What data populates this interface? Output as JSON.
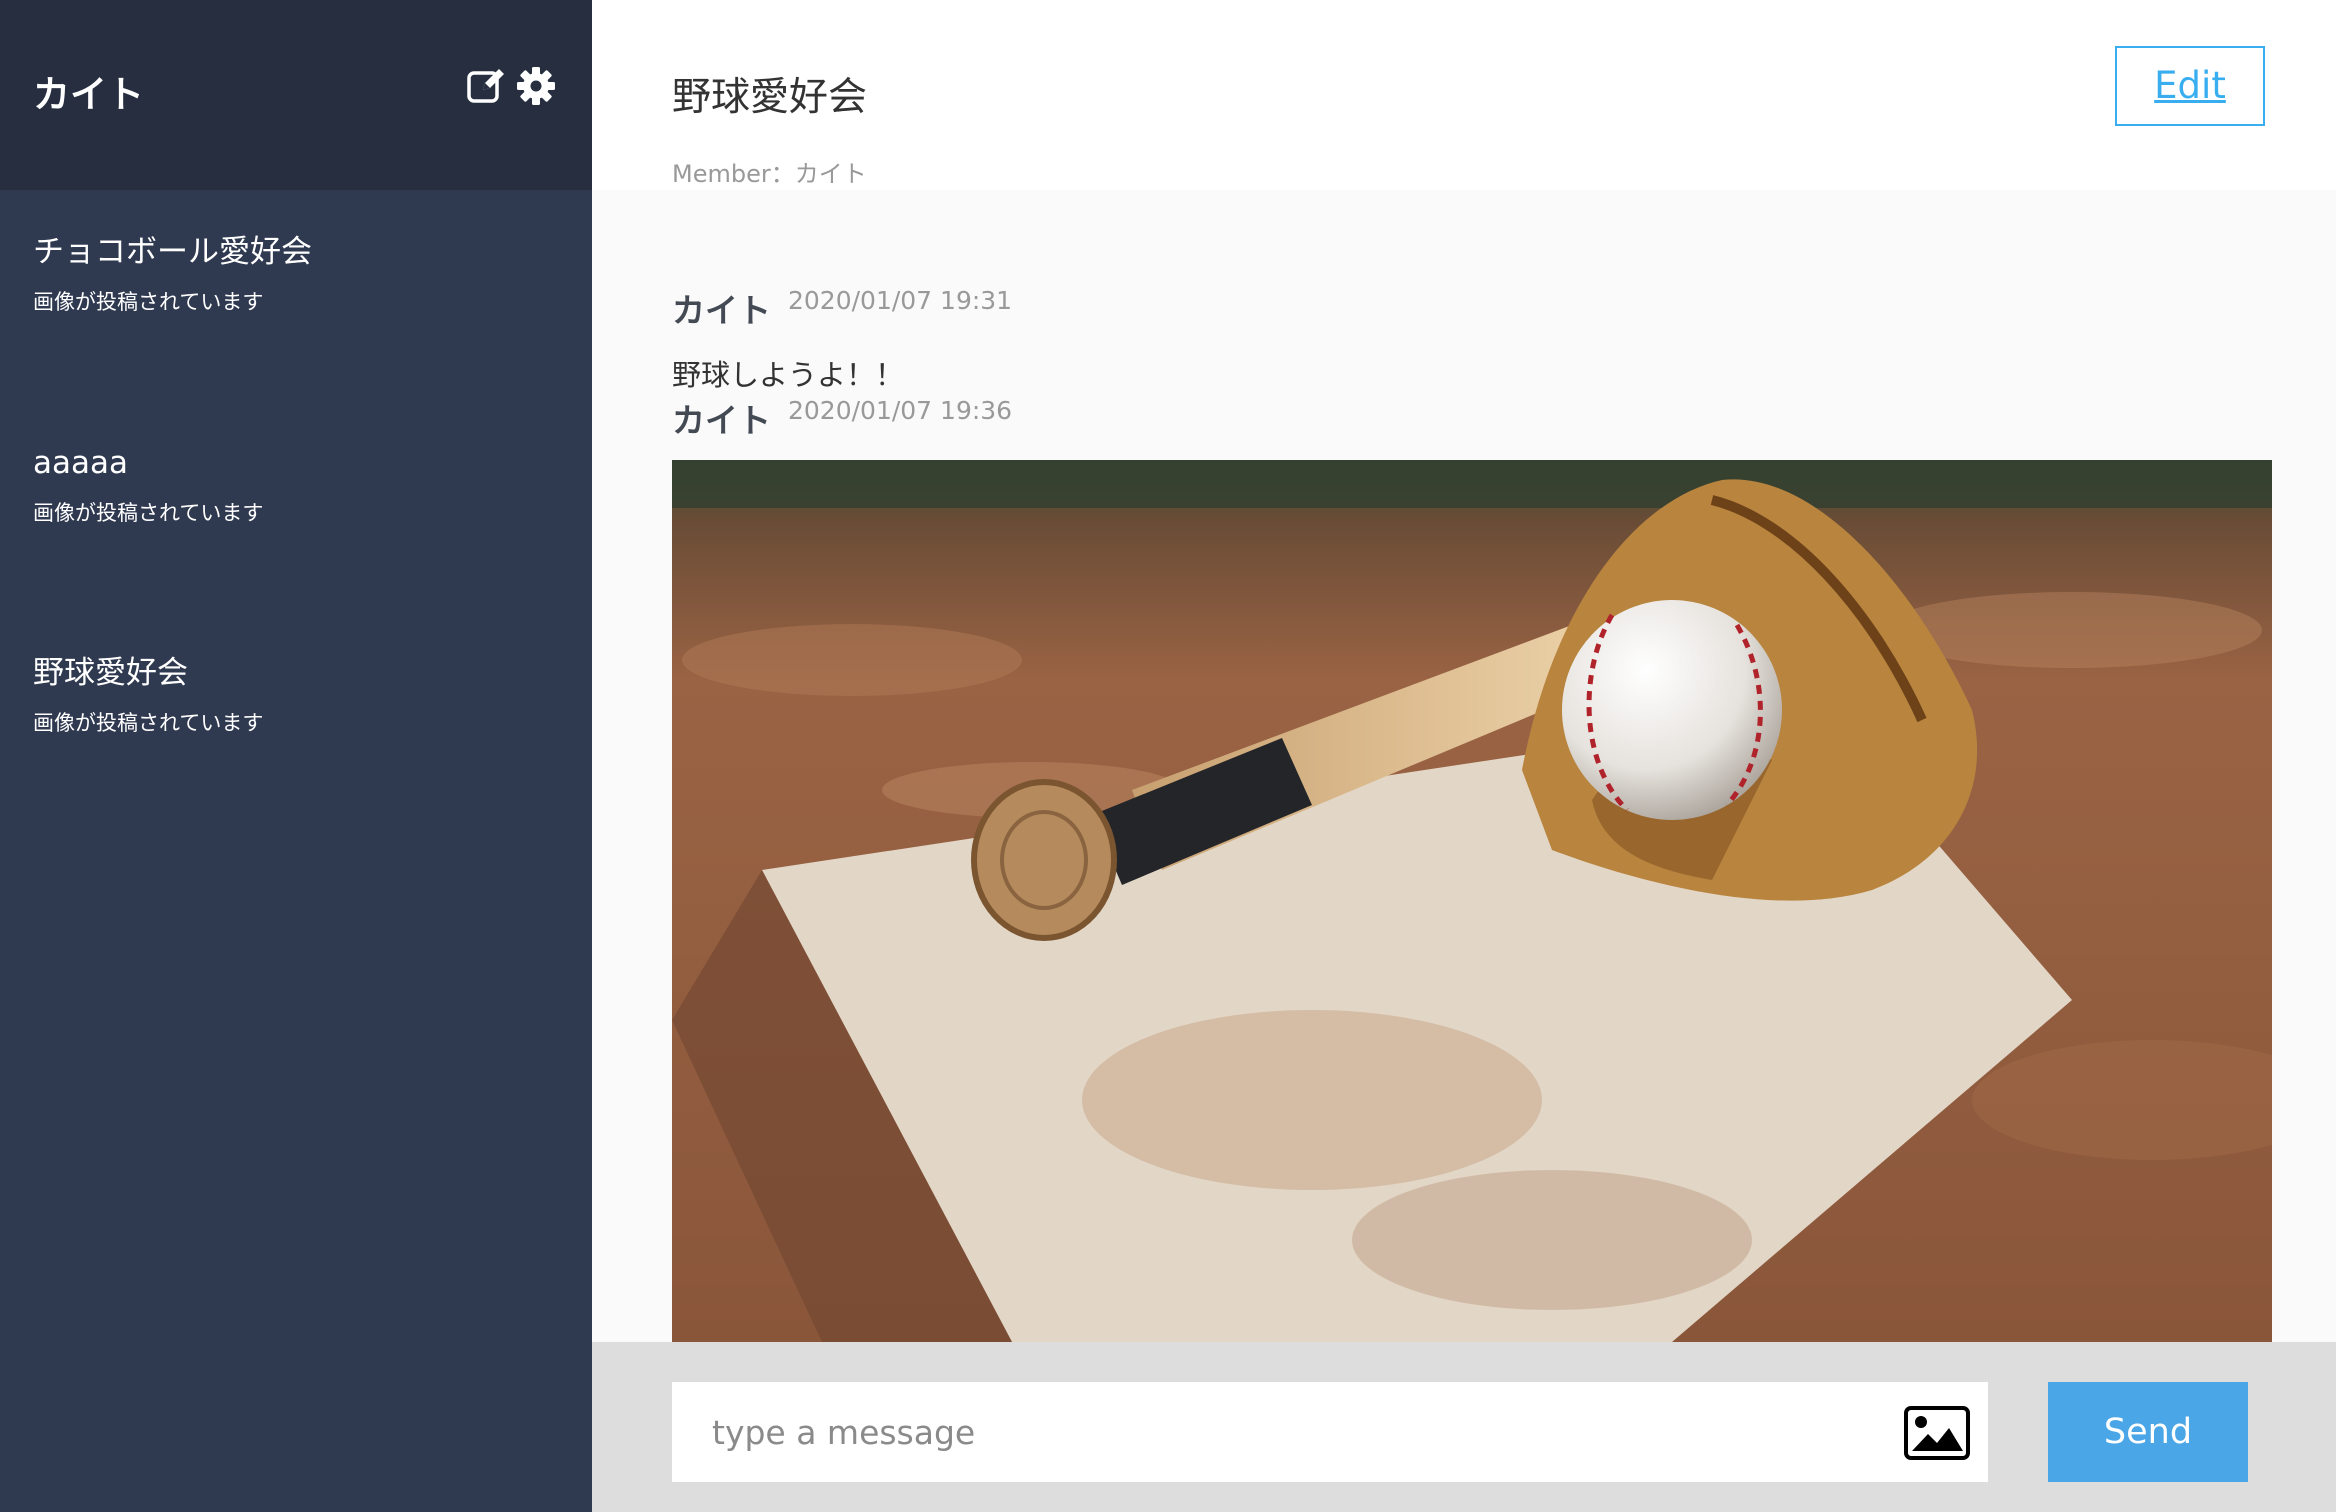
{
  "sidebar": {
    "user_name": "カイト",
    "groups": [
      {
        "name": "チョコボール愛好会",
        "last_message": "画像が投稿されています"
      },
      {
        "name": "aaaaa",
        "last_message": "画像が投稿されています"
      },
      {
        "name": "野球愛好会",
        "last_message": "画像が投稿されています"
      }
    ]
  },
  "header": {
    "group_name": "野球愛好会",
    "members": "Member：カイト",
    "edit_label": "Edit"
  },
  "messages": [
    {
      "author": "カイト",
      "time": "2020/01/07 19:31",
      "text": "野球しようよ！！"
    },
    {
      "author": "カイト",
      "time": "2020/01/07 19:36"
    }
  ],
  "form": {
    "placeholder": "type a message",
    "send_label": "Send"
  },
  "colors": {
    "sidebar_bg": "#2f3950",
    "sidebar_header_bg": "#262e40",
    "accent": "#38aef0",
    "send_button": "#4ba6e7"
  }
}
